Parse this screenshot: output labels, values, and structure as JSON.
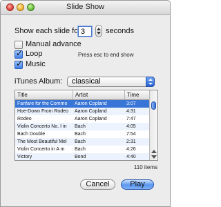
{
  "window": {
    "title": "Slide Show"
  },
  "duration": {
    "prefix": "Show each slide for",
    "value": "3",
    "suffix": "seconds"
  },
  "options": {
    "manual_advance": {
      "label": "Manual advance",
      "checked": false
    },
    "loop": {
      "label": "Loop",
      "checked": true
    },
    "music": {
      "label": "Music",
      "checked": true
    },
    "esc_hint": "Press esc to end show"
  },
  "album": {
    "label": "iTunes Album:",
    "selected": "classical"
  },
  "table": {
    "columns": [
      "Title",
      "Artist",
      "Time"
    ],
    "rows": [
      {
        "title": "Fanfare for the Commo",
        "artist": "Aaron Copland",
        "time": "3:07"
      },
      {
        "title": "Hoe-Down From Rodeo",
        "artist": "Aaron Copland",
        "time": "4:31"
      },
      {
        "title": "Rodeo",
        "artist": "Aaron Copland",
        "time": "7:47"
      },
      {
        "title": "Violin Concerto No. I in",
        "artist": "Bach",
        "time": "4:05"
      },
      {
        "title": "Bach Double",
        "artist": "Bach",
        "time": "7:54"
      },
      {
        "title": "The Most Beautiful Mel",
        "artist": "Bach",
        "time": "2:31"
      },
      {
        "title": "Violin Concerto in A m",
        "artist": "Bach",
        "time": "4:26"
      },
      {
        "title": "Victory",
        "artist": "Bond",
        "time": "4:40"
      }
    ],
    "item_count": "110 items"
  },
  "buttons": {
    "cancel": "Cancel",
    "play": "Play"
  },
  "colors": {
    "selection": "#3875d7",
    "default_button": "#5b97f0"
  }
}
